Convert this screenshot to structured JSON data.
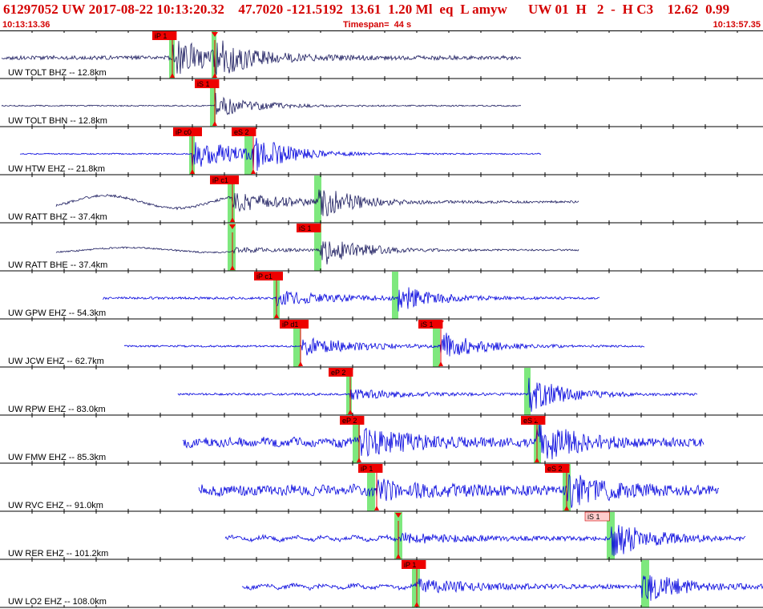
{
  "header": {
    "title": "61297052 UW 2017-08-22 10:13:20.32    47.7020 -121.5192  13.61  1.20 Ml  eq  L amyw      UW 01  H   2  -  H C3    12.62  0.99",
    "start_time": "10:13:13.36",
    "timespan": "Timespan=  44 s",
    "end_time": "10:13:57.35"
  },
  "colors": {
    "background": "#ffffff",
    "header_text": "#d40000",
    "trace_dark": "#1a1a5e",
    "trace_blue": "#0000dd",
    "pick_red": "#ee0000",
    "pick_pink": "#ffcccc",
    "window_green": "#7ee87e",
    "divider": "#000000"
  },
  "traces": [
    {
      "label": "UW TOLT BHZ -- 12.8km",
      "color": "dark",
      "picks": [
        {
          "text": "iP 1",
          "style": "red",
          "arrow": "down"
        },
        {
          "text": "",
          "style": "red",
          "arrow": "up"
        }
      ]
    },
    {
      "label": "UW TOLT BHN -- 12.8km",
      "color": "dark",
      "picks": [
        {
          "text": "iS 1",
          "style": "red",
          "arrow": "down"
        }
      ]
    },
    {
      "label": "UW HTW EHZ -- 21.8km",
      "color": "blue",
      "picks": [
        {
          "text": "iP c0",
          "style": "red",
          "arrow": "down"
        },
        {
          "text": "eS 2",
          "style": "red",
          "arrow": "down"
        }
      ]
    },
    {
      "label": "UW RATT BHZ -- 37.4km",
      "color": "dark",
      "picks": [
        {
          "text": "iP c1",
          "style": "red",
          "arrow": "down"
        }
      ]
    },
    {
      "label": "UW RATT BHE -- 37.4km",
      "color": "dark",
      "picks": [
        {
          "text": "iS 1",
          "style": "red",
          "arrow": "down"
        }
      ]
    },
    {
      "label": "UW GPW EHZ -- 54.3km",
      "color": "blue",
      "picks": [
        {
          "text": "iP c1",
          "style": "red",
          "arrow": "down"
        }
      ]
    },
    {
      "label": "UW JCW EHZ -- 62.7km",
      "color": "blue",
      "picks": [
        {
          "text": "iP d1",
          "style": "red",
          "arrow": "down"
        },
        {
          "text": "iS 1",
          "style": "red",
          "arrow": "down"
        }
      ]
    },
    {
      "label": "UW RPW EHZ -- 83.0km",
      "color": "blue",
      "picks": [
        {
          "text": "eP 2",
          "style": "red",
          "arrow": "down"
        }
      ]
    },
    {
      "label": "UW FMW EHZ -- 85.3km",
      "color": "blue",
      "picks": [
        {
          "text": "eP 2",
          "style": "red",
          "arrow": "down"
        },
        {
          "text": "eS 2",
          "style": "red",
          "arrow": "down"
        }
      ]
    },
    {
      "label": "UW RVC EHZ -- 91.0km",
      "color": "blue",
      "picks": [
        {
          "text": "iP 1",
          "style": "red",
          "arrow": "down"
        },
        {
          "text": "eS 2",
          "style": "red",
          "arrow": "down"
        }
      ]
    },
    {
      "label": "UW RER EHZ -- 101.2km",
      "color": "blue",
      "picks": [
        {
          "text": "iS 1",
          "style": "pink",
          "arrow": "down"
        }
      ]
    },
    {
      "label": "UW LO2 EHZ -- 108.0km",
      "color": "blue",
      "picks": [
        {
          "text": "iP 1",
          "style": "red",
          "arrow": "down"
        }
      ]
    }
  ]
}
